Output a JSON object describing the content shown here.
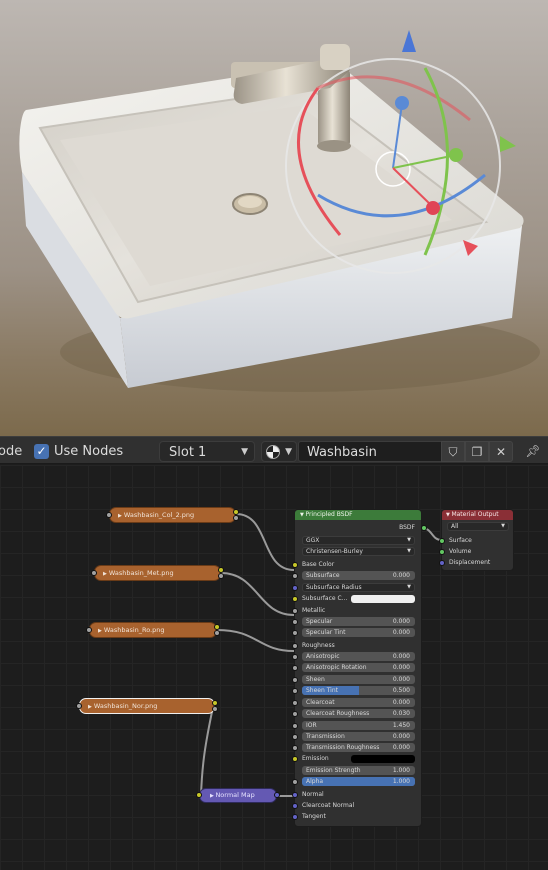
{
  "header": {
    "mode_label": "ode",
    "use_nodes_label": "Use Nodes",
    "use_nodes_checked": true,
    "slot_value": "Slot 1",
    "material_name": "Washbasin"
  },
  "nodes": {
    "textures": [
      {
        "label": "Washbasin_Col_2.png"
      },
      {
        "label": "Washbasin_Met.png"
      },
      {
        "label": "Washbasin_Ro.png"
      },
      {
        "label": "Washbasin_Nor.png"
      }
    ],
    "normal_map": {
      "label": "Normal Map"
    },
    "bsdf": {
      "title": "Principled BSDF",
      "output_label": "BSDF",
      "distribution": "GGX",
      "subsurface_method": "Christensen-Burley",
      "base_color": "Base Color",
      "subsurface": {
        "label": "Subsurface",
        "value": "0.000"
      },
      "subsurface_radius": "Subsurface Radius",
      "subsurface_color": "Subsurface C...",
      "metallic": "Metallic",
      "specular": {
        "label": "Specular",
        "value": "0.000"
      },
      "specular_tint": {
        "label": "Specular Tint",
        "value": "0.000"
      },
      "roughness": "Roughness",
      "anisotropic": {
        "label": "Anisotropic",
        "value": "0.000"
      },
      "anisotropic_rotation": {
        "label": "Anisotropic Rotation",
        "value": "0.000"
      },
      "sheen": {
        "label": "Sheen",
        "value": "0.000"
      },
      "sheen_tint": {
        "label": "Sheen Tint",
        "value": "0.500",
        "fraction": 0.5
      },
      "clearcoat": {
        "label": "Clearcoat",
        "value": "0.000"
      },
      "clearcoat_roughness": {
        "label": "Clearcoat Roughness",
        "value": "0.030"
      },
      "ior": {
        "label": "IOR",
        "value": "1.450"
      },
      "transmission": {
        "label": "Transmission",
        "value": "0.000"
      },
      "transmission_roughness": {
        "label": "Transmission Roughness",
        "value": "0.000"
      },
      "emission": "Emission",
      "emission_strength": {
        "label": "Emission Strength",
        "value": "1.000"
      },
      "alpha": {
        "label": "Alpha",
        "value": "1.000",
        "fraction": 1.0
      },
      "normal": "Normal",
      "clearcoat_normal": "Clearcoat Normal",
      "tangent": "Tangent"
    },
    "output": {
      "title": "Material Output",
      "target": "All",
      "surface": "Surface",
      "volume": "Volume",
      "displacement": "Displacement"
    }
  },
  "colors": {
    "texture_node": "#a8622e",
    "bsdf_header": "#3c7b3a",
    "output_header": "#8a2f36",
    "normal_map_node": "#6459b3",
    "accent": "#4772b3"
  }
}
